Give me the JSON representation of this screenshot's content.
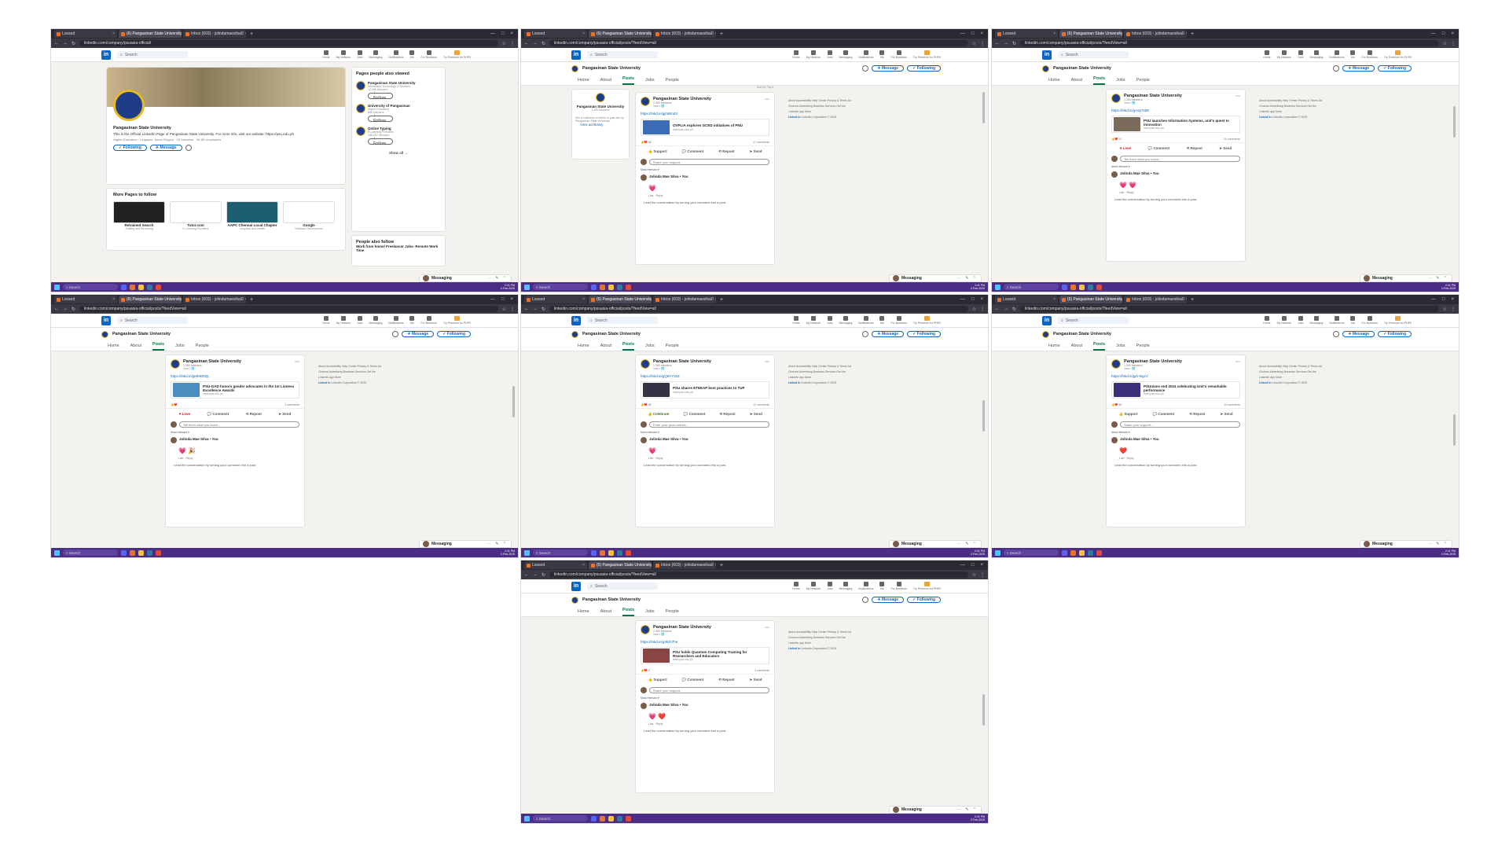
{
  "browser": {
    "tabs": [
      "Lossed",
      "(6) Pangasinan State University",
      "Inbox (603) - jolindamaesilva0"
    ],
    "tab_active": "(6) Pangasinan State University",
    "url_main": "linkedin.com/company/psuasia-official/",
    "url_posts": "linkedin.com/company/psuasia-official/posts/?feedView=all"
  },
  "linkedin": {
    "search_placeholder": "Search",
    "nav": [
      "Home",
      "My Network",
      "Jobs",
      "Messaging",
      "Notifications",
      "Me",
      "For Business"
    ],
    "premium": "Try Premium for PHP0",
    "org_name": "Pangasinan State University",
    "message_btn": "Message",
    "following_btn": "Following",
    "tabs": [
      "Home",
      "About",
      "Posts",
      "Jobs",
      "People"
    ],
    "active_tab": "Posts"
  },
  "profile": {
    "name": "Pangasinan State University",
    "desc": "This is the Official LinkedIn Page of Pangasinan State University. For more info, visit our website: https://psu.edu.ph",
    "meta": "Higher Education · Lingayen, Ilocos Region · 1K followers · 1K-5K employees",
    "following": "Following",
    "message": "Message",
    "more_pages_title": "More Pages to follow",
    "more_pages": [
      {
        "name": "Retrained Search",
        "sub": "Staffing and Recruiting"
      },
      {
        "name": "Tutor.com",
        "sub": "E-Learning Providers"
      },
      {
        "name": "AAPC Chennai Local Chapter",
        "sub": "Hospitals and Health"
      },
      {
        "name": "Google",
        "sub": "Software Development"
      }
    ],
    "also_viewed_title": "Pages people also viewed",
    "also_viewed": [
      {
        "name": "Pangasinan State University",
        "sub": "Information Technology & Services",
        "fol": "12,296 followers"
      },
      {
        "name": "University of Pangasinan",
        "sub": "Higher Education",
        "fol": "885 followers"
      },
      {
        "name": "Online Typing",
        "sub": "E-Learning Providers",
        "fol": "185,287 followers"
      }
    ],
    "follow": "Follow",
    "show_all": "Show all",
    "also_follow_title": "People also follow",
    "also_follow_item": "Work from home/ Freelancer Jobs- Remote Work Time"
  },
  "sidebar_org": {
    "name": "Pangasinan State University",
    "fol": "1,390 followers",
    "desc": "See a collection of active or past ads by Pangasinan State University.",
    "view": "View ad library",
    "sort": "Sort by: Top"
  },
  "posts": [
    {
      "followers": "1,390 followers",
      "age": "1mo",
      "link": "https://lnkd.in/gjmBmdX",
      "title": "OVPLIA explores GCED initiatives of PNU",
      "src": "main.psu.edu.ph",
      "reactions": "48",
      "comments": "17 comments",
      "first_action": "Support",
      "input": "Share your support...",
      "commenter": "Jolinda Mae Silva",
      "emoji": "💗",
      "thumb": "#3b6cb7"
    },
    {
      "followers": "1,390 followers",
      "age": "1mo",
      "link": "https://lnkd.in/gAsp7s08",
      "title": "PSU launches Information Systems, unit's quest to innovation",
      "src": "main.psu.edu.ph",
      "reactions": "47",
      "comments": "15 comments",
      "first_action": "Love",
      "input": "Tell them what you loved...",
      "commenter": "Jolinda Mae Silva",
      "emoji": "💗 💗",
      "thumb": "#7a6a5a"
    },
    {
      "followers": "1,390 followers",
      "age": "1mo",
      "link": "https://lnkd.in/gMh83NQ",
      "title": "PSU-GAD honors gender advocates in the 1st Lioness Excellence Awards",
      "src": "main.psu.edu.ph",
      "reactions": "",
      "comments": "4 comments",
      "first_action": "Love",
      "input": "Tell them what you loved...",
      "commenter": "Jolinda Mae Silva",
      "emoji": "💗 🎉",
      "thumb": "#4a8fc0"
    },
    {
      "followers": "1,390 followers",
      "age": "1mo",
      "link": "https://lnkd.in/gQ8YYx53",
      "title": "PSU shares ETEEAP best practices to TUP",
      "src": "main.psu.edu.ph",
      "reactions": "48",
      "comments": "10 comments",
      "first_action": "Celebrate",
      "input": "Enter your good wishes...",
      "commenter": "Jolinda Mae Silva",
      "emoji": "💗",
      "thumb": "#333344"
    },
    {
      "followers": "1,390 followers",
      "age": "1mo",
      "link": "https://lnkd.in/gZr-BgzV",
      "title": "PSUnians end 2024 celebrating Unit's remarkable performance",
      "src": "main.psu.edu.ph",
      "reactions": "62",
      "comments": "24 comments",
      "first_action": "Support",
      "input": "Share your support...",
      "commenter": "Jolinda Mae Silva",
      "emoji": "❤️",
      "thumb": "#3a2f7a"
    },
    {
      "followers": "1,390 followers",
      "age": "1mo",
      "link": "https://lnkd.in/g3kzh7he",
      "title": "PSU holds Quantum Computing Training for Researchers and Educators",
      "src": "main.psu.edu.ph",
      "reactions": "3",
      "comments": "3 comments",
      "first_action": "Support",
      "input": "Share your support...",
      "commenter": "Jolinda Mae Silva",
      "emoji": "💗 ❤️",
      "thumb": "#8a4444"
    }
  ],
  "post_labels": {
    "comment": "Comment",
    "repost": "Repost",
    "send": "Send",
    "most_relevant": "Most relevant",
    "like_reply": "Like · Reply",
    "lead": "Lead the conversation by turning your comment into a post.",
    "repost_btn": "Repost"
  },
  "footer": [
    "About",
    "Accessibility",
    "Help Center",
    "Privacy & Terms",
    "Ad Choices",
    "Advertising",
    "Business Services",
    "Get the LinkedIn app",
    "More"
  ],
  "footer_corp": "LinkedIn Corporation © 2025",
  "messaging": "Messaging",
  "taskbar": {
    "search": "Search",
    "time": "2:41 PM",
    "date": "2-Feb-2025"
  },
  "colors": {
    "linkedin_blue": "#0a66c2",
    "posts_green": "#057642",
    "taskbar": "#4b2d86",
    "browser_chrome": "#2b2a33"
  }
}
